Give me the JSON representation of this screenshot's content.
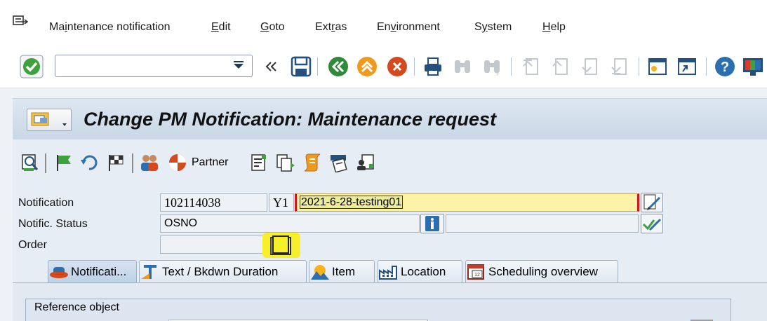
{
  "menu": {
    "items": [
      "Maintenance notification",
      "Edit",
      "Goto",
      "Extras",
      "Environment",
      "System",
      "Help"
    ],
    "mnemonics": [
      "i",
      "E",
      "G",
      "r",
      "v",
      "y",
      "H"
    ]
  },
  "toolbar": {
    "command_value": "",
    "icons": [
      "check-icon",
      "command-dropdown-icon",
      "double-left-icon",
      "save-icon",
      "back-icon",
      "exit-icon",
      "cancel-icon",
      "print-icon",
      "find-icon",
      "find-next-icon",
      "first-page-icon",
      "prev-page-icon",
      "next-page-icon",
      "last-page-icon",
      "new-session-icon",
      "shortcut-icon",
      "help-icon",
      "customize-layout-icon"
    ]
  },
  "screen": {
    "title": "Change PM Notification: Maintenance request"
  },
  "app_toolbar": {
    "partner_label": "Partner"
  },
  "header": {
    "notification_label": "Notification",
    "notification_number": "102114038",
    "notification_type": "Y1",
    "notification_text": "2021-6-28-testing01",
    "status_label": "Notific. Status",
    "status_value": "OSNO",
    "order_label": "Order",
    "order_value": ""
  },
  "tabs": [
    {
      "label": "Notificati...",
      "icon": "notification-hat-icon",
      "active": true
    },
    {
      "label": "Text / Bkdwn Duration",
      "icon": "text-duration-icon",
      "active": false
    },
    {
      "label": "Item",
      "icon": "item-mountain-icon",
      "active": false
    },
    {
      "label": "Location",
      "icon": "location-factory-icon",
      "active": false
    },
    {
      "label": "Scheduling overview",
      "icon": "calendar-icon",
      "active": false
    }
  ],
  "tab_content": {
    "group_title": "Reference object"
  },
  "colors": {
    "title_bar": "#c9d7e6",
    "input_highlight": "#fef2a8",
    "active_tab": "#bcd1e6",
    "order_button_highlight": "#f7ef2a"
  }
}
